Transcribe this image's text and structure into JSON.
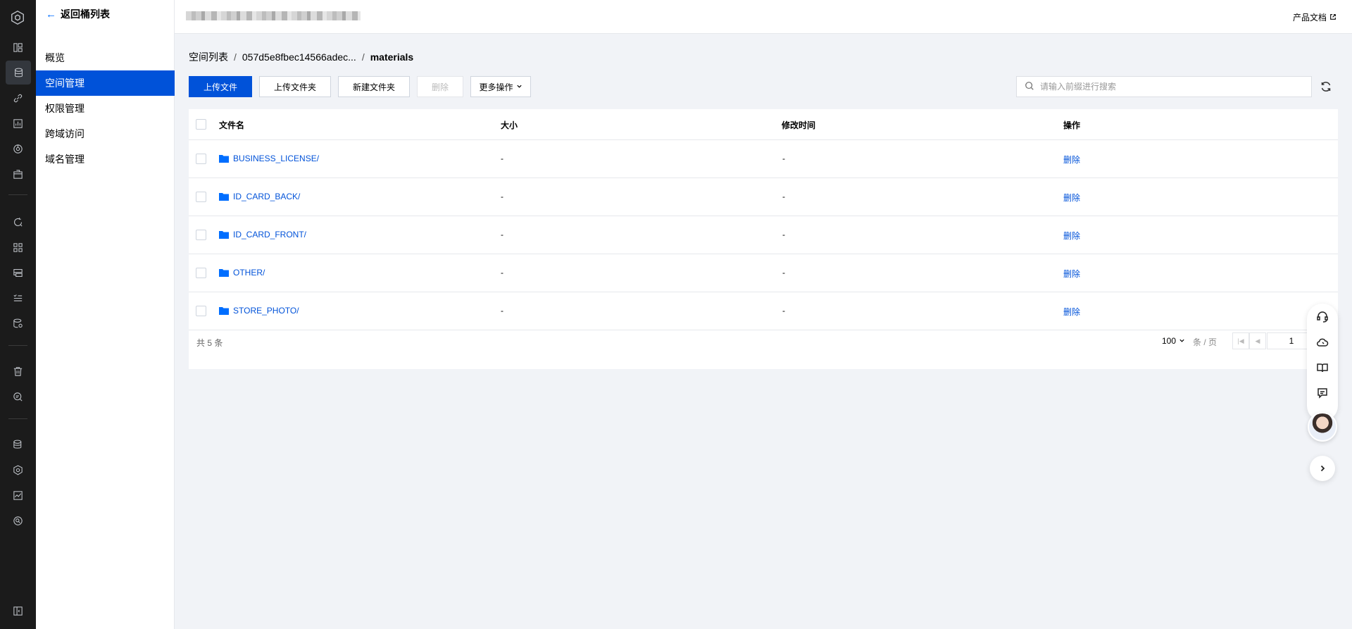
{
  "sidebar": {
    "back_label": "返回桶列表",
    "items": [
      {
        "label": "概览"
      },
      {
        "label": "空间管理"
      },
      {
        "label": "权限管理"
      },
      {
        "label": "跨域访问"
      },
      {
        "label": "域名管理"
      }
    ],
    "active_index": 1
  },
  "topbar": {
    "product_doc": "产品文档"
  },
  "breadcrumb": {
    "root": "空间列表",
    "bucket": "057d5e8fbec14566adec...",
    "current": "materials",
    "separator": "/"
  },
  "toolbar": {
    "upload_file": "上传文件",
    "upload_folder": "上传文件夹",
    "new_folder": "新建文件夹",
    "delete": "删除",
    "more_actions": "更多操作"
  },
  "search": {
    "placeholder": "请输入前缀进行搜索",
    "value": ""
  },
  "table": {
    "columns": [
      "文件名",
      "大小",
      "修改时间",
      "操作"
    ],
    "rows": [
      {
        "name": "BUSINESS_LICENSE/",
        "size": "-",
        "modified": "-",
        "action": "删除"
      },
      {
        "name": "ID_CARD_BACK/",
        "size": "-",
        "modified": "-",
        "action": "删除"
      },
      {
        "name": "ID_CARD_FRONT/",
        "size": "-",
        "modified": "-",
        "action": "删除"
      },
      {
        "name": "OTHER/",
        "size": "-",
        "modified": "-",
        "action": "删除"
      },
      {
        "name": "STORE_PHOTO/",
        "size": "-",
        "modified": "-",
        "action": "删除"
      }
    ]
  },
  "pagination": {
    "total": "共 5 条",
    "page_size": "100",
    "unit": "条 / 页",
    "page": "1"
  },
  "icons": {
    "rail": [
      "cos-logo-icon",
      "dashboard-icon",
      "bucket-icon",
      "link-icon",
      "chart-icon",
      "monitor-icon",
      "package-icon",
      "refresh-search-icon",
      "apps-icon",
      "layout-icon",
      "list-check-icon",
      "storage-settings-icon",
      "trash-icon",
      "message-search-icon",
      "database-icon",
      "shield-icon",
      "trend-icon",
      "search-circle-icon",
      "collapse-panel-icon"
    ],
    "float": [
      "headset-icon",
      "cloud-icon",
      "book-icon",
      "feedback-icon"
    ]
  },
  "colors": {
    "primary": "#0052d9",
    "link": "#0052d9",
    "rail_bg": "#1b1b1b",
    "page_bg": "#f1f3f7"
  }
}
